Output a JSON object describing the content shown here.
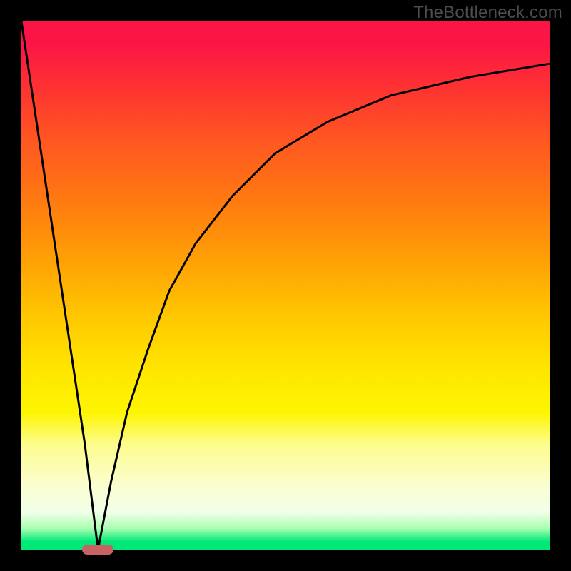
{
  "watermark": "TheBottleneck.com",
  "colors": {
    "frame": "#000000",
    "curve": "#000000",
    "marker": "#c96262"
  },
  "chart_data": {
    "type": "line",
    "title": "",
    "xlabel": "",
    "ylabel": "",
    "xlim": [
      0,
      100
    ],
    "ylim": [
      0,
      100
    ],
    "grid": false,
    "series": [
      {
        "name": "left-curve",
        "x": [
          0,
          3,
          6,
          9,
          12,
          14.5
        ],
        "values": [
          100,
          80,
          60,
          40,
          20,
          0
        ]
      },
      {
        "name": "right-curve",
        "x": [
          14.5,
          17,
          20,
          24,
          28,
          33,
          40,
          48,
          58,
          70,
          85,
          100
        ],
        "values": [
          0,
          13,
          26,
          38,
          49,
          58,
          67,
          75,
          81,
          86,
          89.5,
          92
        ]
      }
    ],
    "annotations": [
      {
        "name": "min-marker",
        "x": 14.5,
        "y": 0,
        "shape": "pill"
      }
    ],
    "background_gradient": {
      "direction": "vertical",
      "stops": [
        {
          "pos": 0.0,
          "color": "#fb1446"
        },
        {
          "pos": 0.12,
          "color": "#fe3033"
        },
        {
          "pos": 0.34,
          "color": "#ff7a11"
        },
        {
          "pos": 0.56,
          "color": "#ffc800"
        },
        {
          "pos": 0.74,
          "color": "#fdf500"
        },
        {
          "pos": 0.88,
          "color": "#fbfed1"
        },
        {
          "pos": 0.96,
          "color": "#a8ffb0"
        },
        {
          "pos": 1.0,
          "color": "#00e878"
        }
      ]
    }
  }
}
